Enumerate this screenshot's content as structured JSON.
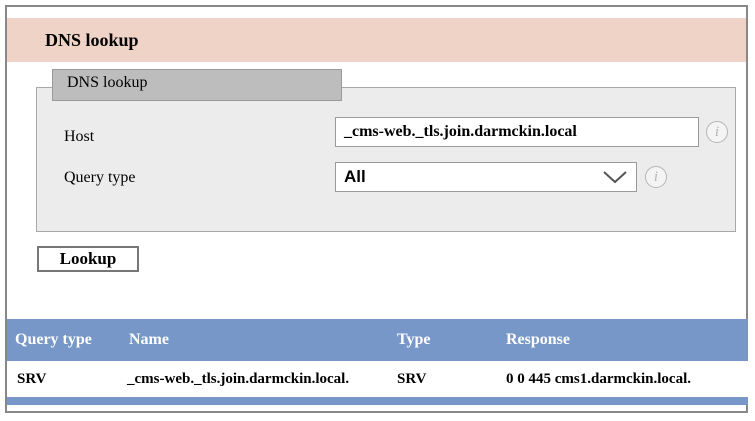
{
  "header": {
    "title": "DNS lookup"
  },
  "form": {
    "legend": "DNS lookup",
    "host_label": "Host",
    "host_value": "_cms-web._tls.join.darmckin.local",
    "query_type_label": "Query type",
    "query_type_value": "All",
    "info_glyph": "i",
    "lookup_button": "Lookup"
  },
  "results": {
    "columns": [
      "Query type",
      "Name",
      "Type",
      "Response"
    ],
    "rows": [
      [
        "SRV",
        "_cms-web._tls.join.darmckin.local.",
        "SRV",
        "0 0 445 cms1.darmckin.local."
      ]
    ]
  },
  "colors": {
    "header_bg": "#efd3c7",
    "table_header_bg": "#7797c8"
  }
}
